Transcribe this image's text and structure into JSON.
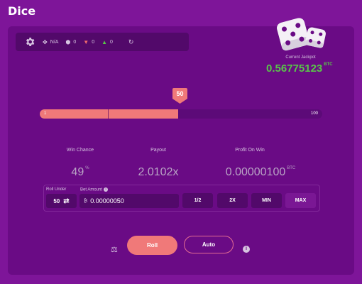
{
  "app": {
    "title": "Dice"
  },
  "stats_bar": {
    "luck": "N/A",
    "bets": "0",
    "losses": "0",
    "wins": "0"
  },
  "jackpot": {
    "label": "Current Jackpot",
    "value": "0.56775123",
    "unit": "BTC"
  },
  "slider": {
    "min": "1",
    "max": "100",
    "value": "50",
    "fill_percent": 49
  },
  "stats": {
    "win_chance_label": "Win Chance",
    "win_chance_value": "49",
    "win_chance_unit": "%",
    "payout_label": "Payout",
    "payout_value": "2.0102x",
    "profit_label": "Profit On Win",
    "profit_value": "0.00000100",
    "profit_unit": "BTC"
  },
  "controls": {
    "roll_under_label": "Roll Under",
    "roll_under_value": "50",
    "bet_amount_label": "Bet Amount",
    "bet_amount_value": "0.00000050",
    "half_label": "1/2",
    "double_label": "2X",
    "min_label": "MIN",
    "max_label": "MAX"
  },
  "actions": {
    "roll_label": "Roll",
    "auto_label": "Auto"
  },
  "colors": {
    "background": "#7e1599",
    "panel": "#6a0b85",
    "accent": "#f07979",
    "jackpot_green": "#59c649"
  },
  "icons": {
    "settings": "gear-icon",
    "luck": "clover-icon",
    "bets": "dice-icon",
    "losses": "triangle-down-icon",
    "wins": "triangle-up-icon",
    "refresh": "refresh-icon",
    "swap": "swap-icon",
    "currency": "bitcoin-icon",
    "fairness": "scale-icon",
    "info": "info-icon"
  }
}
